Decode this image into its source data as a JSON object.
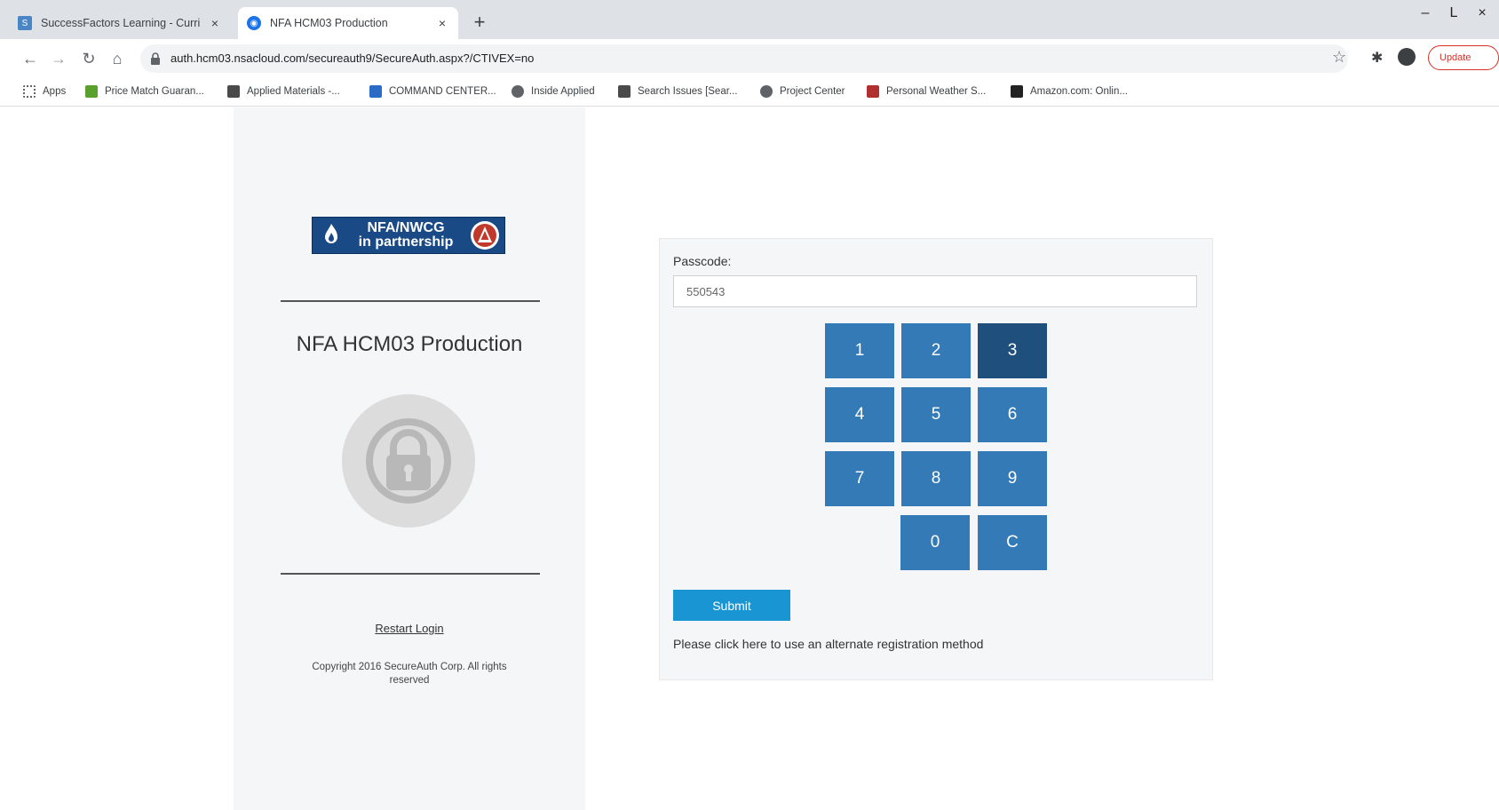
{
  "browser": {
    "tabs": [
      {
        "title": "SuccessFactors Learning - Curri",
        "active": false
      },
      {
        "title": "NFA HCM03 Production",
        "active": true
      }
    ],
    "new_tab_label": "+",
    "close_label": "×",
    "window": {
      "minimize": "–",
      "restore": "L",
      "close": "×"
    },
    "url": "auth.hcm03.nsacloud.com/secureauth9/SecureAuth.aspx?/CTIVEX=no",
    "update_label": "Update",
    "bookmarks": [
      {
        "label": "Apps",
        "icon": "apps-grid-icon",
        "color": "#5f6368"
      },
      {
        "label": "Price Match Guaran...",
        "icon": "bookmark-green-icon",
        "color": "#5aa02c"
      },
      {
        "label": "Applied Materials -...",
        "icon": "bookmark-applied-icon",
        "color": "#4a4a4a"
      },
      {
        "label": "COMMAND CENTER...",
        "icon": "bookmark-blue-icon",
        "color": "#2a6bc6"
      },
      {
        "label": "Inside Applied",
        "icon": "globe-icon",
        "color": "#5f6368"
      },
      {
        "label": "Search Issues [Sear...",
        "icon": "bookmark-applied-icon",
        "color": "#4a4a4a"
      },
      {
        "label": "Project Center",
        "icon": "globe-icon",
        "color": "#5f6368"
      },
      {
        "label": "Personal Weather S...",
        "icon": "bookmark-weather-icon",
        "color": "#b03030"
      },
      {
        "label": "Amazon.com: Onlin...",
        "icon": "amazon-icon",
        "color": "#222222"
      }
    ]
  },
  "left": {
    "logo_text_line1": "NFA/NWCG",
    "logo_text_line2": "in partnership",
    "app_title": "NFA HCM03 Production",
    "restart_link": "Restart Login",
    "copyright": "Copyright 2016 SecureAuth Corp. All rights reserved"
  },
  "form": {
    "passcode_label": "Passcode:",
    "passcode_value": "550543",
    "keys": [
      "1",
      "2",
      "3",
      "4",
      "5",
      "6",
      "7",
      "8",
      "9",
      "0",
      "C"
    ],
    "submit_label": "Submit",
    "alt_text": "Please click here to use an alternate registration method"
  },
  "colors": {
    "key_blue": "#337ab7",
    "key_pressed": "#1f4f7d",
    "submit_blue": "#1a95d3",
    "panel_bg": "#f5f6f7"
  }
}
